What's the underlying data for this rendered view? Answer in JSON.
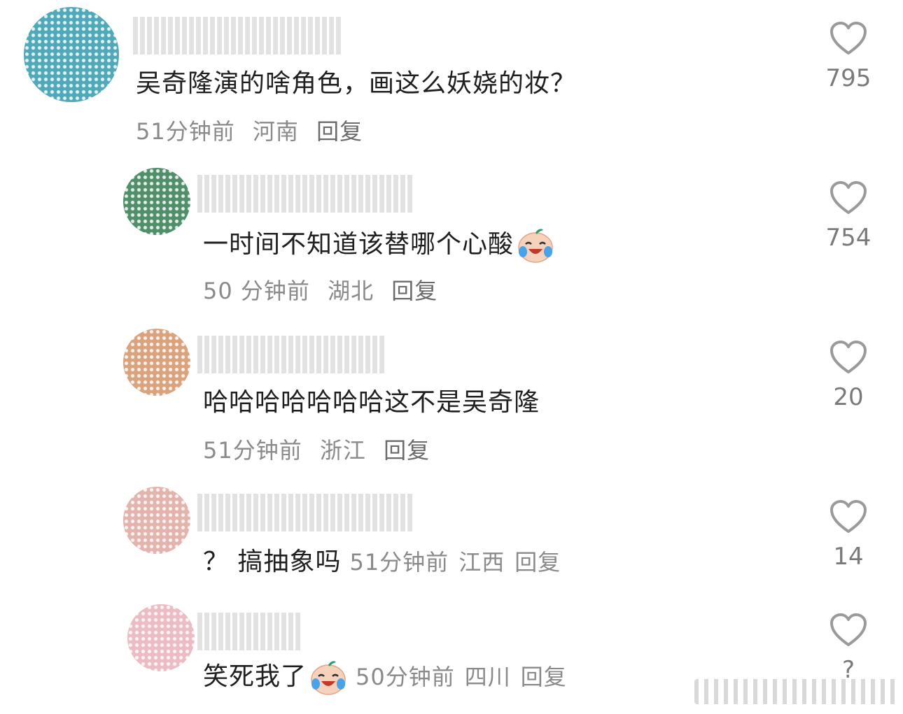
{
  "comments": [
    {
      "text": "吴奇隆演的啥角色，画这么妖娆的妆？",
      "time": "51分钟前",
      "location": "河南",
      "reply_label": "回复",
      "likes": "795",
      "is_reply": false
    },
    {
      "text": "一时间不知道该替哪个心酸",
      "emoji": "crying-laughing-emoji",
      "time": "50 分钟前",
      "location": "湖北",
      "reply_label": "回复",
      "likes": "754",
      "is_reply": true
    },
    {
      "text": "哈哈哈哈哈哈哈这不是吴奇隆",
      "time": "51分钟前",
      "location": "浙江",
      "reply_label": "回复",
      "likes": "20",
      "is_reply": true
    },
    {
      "text": "？ 搞抽象吗",
      "time": "51分钟前",
      "location": "江西",
      "reply_label": "回复",
      "likes": "14",
      "is_reply": true
    },
    {
      "text": "笑死我了",
      "emoji": "crying-laughing-emoji",
      "time": "50分钟前",
      "location": "四川",
      "reply_label": "回复",
      "likes": "?",
      "is_reply": true
    }
  ],
  "colors": {
    "text": "#1f1f1f",
    "meta": "#8a8a8a",
    "heart_outline": "#9a9a9a"
  }
}
